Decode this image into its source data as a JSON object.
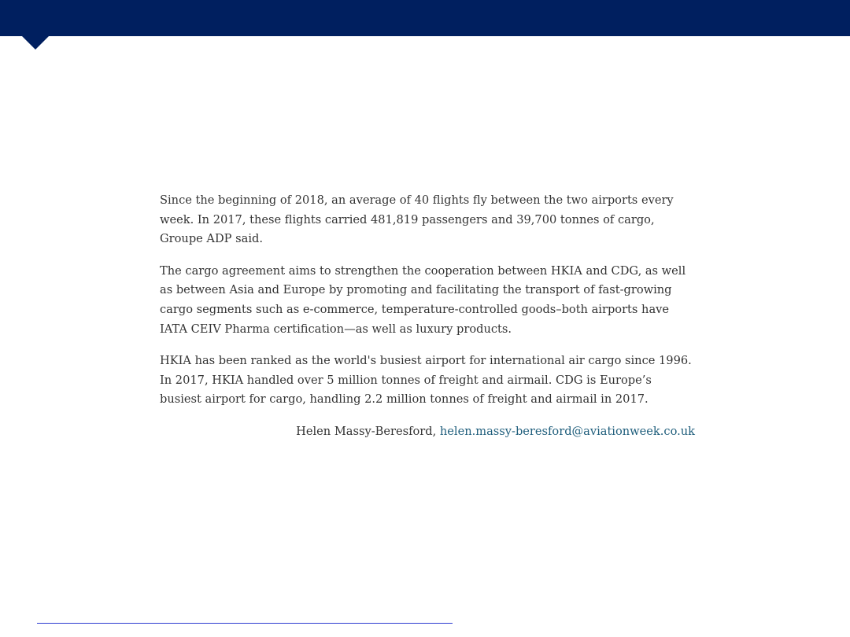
{
  "article": {
    "paragraphs": [
      "Since the beginning of 2018, an average of 40 flights fly between the two airports every week. In 2017, these flights carried 481,819 passengers and 39,700 tonnes of cargo, Groupe ADP said.",
      "The cargo agreement aims to strengthen the cooperation between HKIA and CDG, as well as between Asia and Europe by promoting and facilitating the transport of fast-growing cargo segments such as e-commerce, temperature-controlled goods–both airports have IATA CEIV Pharma certification—as well as luxury products.",
      "HKIA has been ranked as the world's busiest airport for international air cargo since 1996. In 2017, HKIA handled over 5 million tonnes of freight and airmail. CDG is Europe’s busiest airport for cargo, handling 2.2 million tonnes of freight and airmail in 2017."
    ],
    "byline": {
      "author": "Helen Massy-Beresford, ",
      "email": "helen.massy-beresford@aviationweek.co.uk"
    }
  },
  "colors": {
    "header_bar": "#001f5f",
    "link": "#1f5e7c",
    "footnote_rule": "#2b3bd1"
  }
}
